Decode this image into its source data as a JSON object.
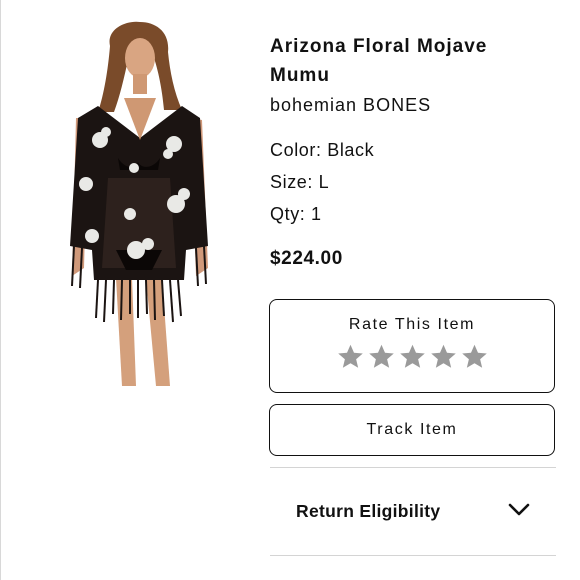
{
  "product": {
    "title_line1": "Arizona Floral Mojave",
    "title_line2": "Mumu",
    "brand": "bohemian BONES",
    "color": "Color: Black",
    "size": "Size: L",
    "qty": "Qty: 1",
    "price": "$224.00",
    "image_icon": "product-photo"
  },
  "rating": {
    "label": "Rate This Item",
    "stars_total": 5,
    "stars_filled": 0,
    "star_color": "#9a9a9a",
    "icon": "star-icon"
  },
  "track": {
    "label": "Track Item"
  },
  "returns": {
    "label": "Return Eligibility",
    "icon": "chevron-down-icon"
  },
  "colors": {
    "text": "#111111",
    "border": "#111111",
    "divider": "#d4d4d4",
    "star": "#9a9a9a"
  }
}
